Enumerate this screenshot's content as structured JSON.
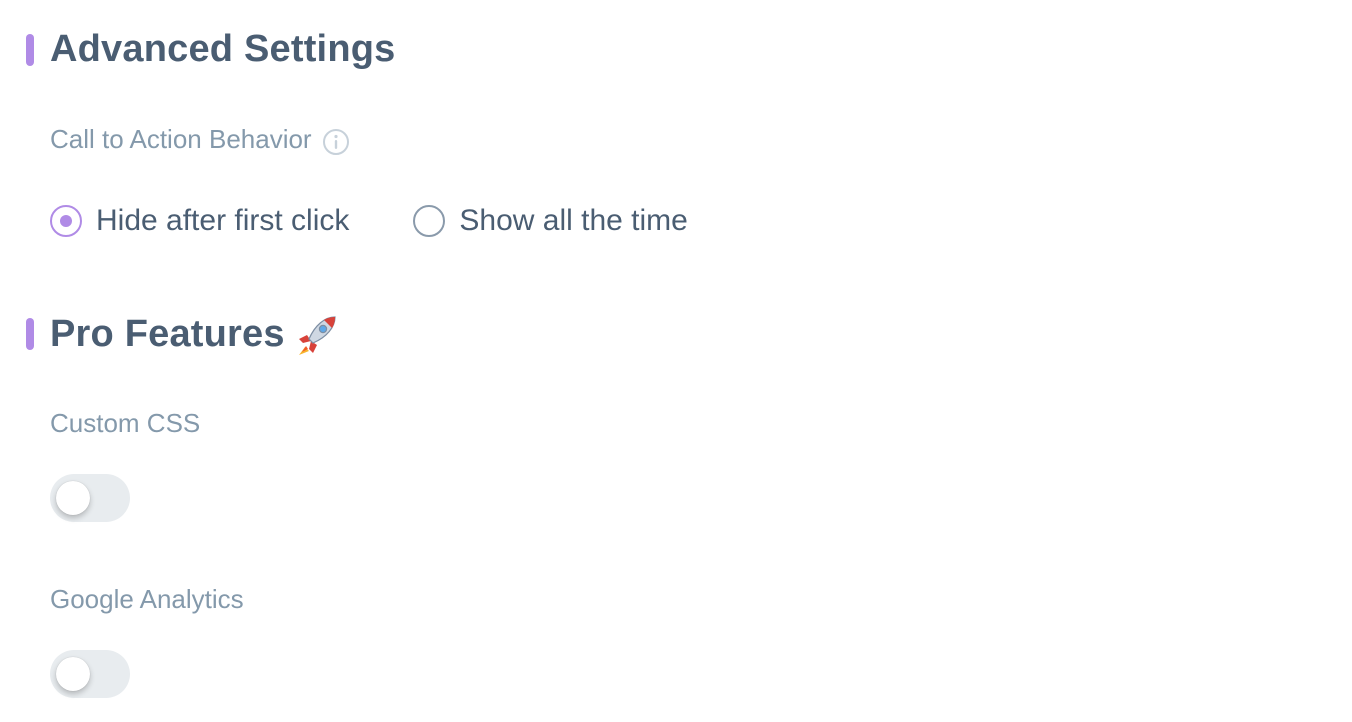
{
  "advanced": {
    "title": "Advanced Settings",
    "cta_label": "Call to Action Behavior",
    "options": [
      {
        "label": "Hide after first click",
        "selected": true
      },
      {
        "label": "Show all the time",
        "selected": false
      }
    ]
  },
  "pro": {
    "title": "Pro Features",
    "title_icon": "rocket-icon",
    "custom_css": {
      "label": "Custom CSS",
      "enabled": false
    },
    "google_analytics": {
      "label": "Google Analytics",
      "enabled": false
    }
  },
  "colors": {
    "accent": "#b08be6",
    "heading": "#4a5d72",
    "label": "#8499ab"
  }
}
